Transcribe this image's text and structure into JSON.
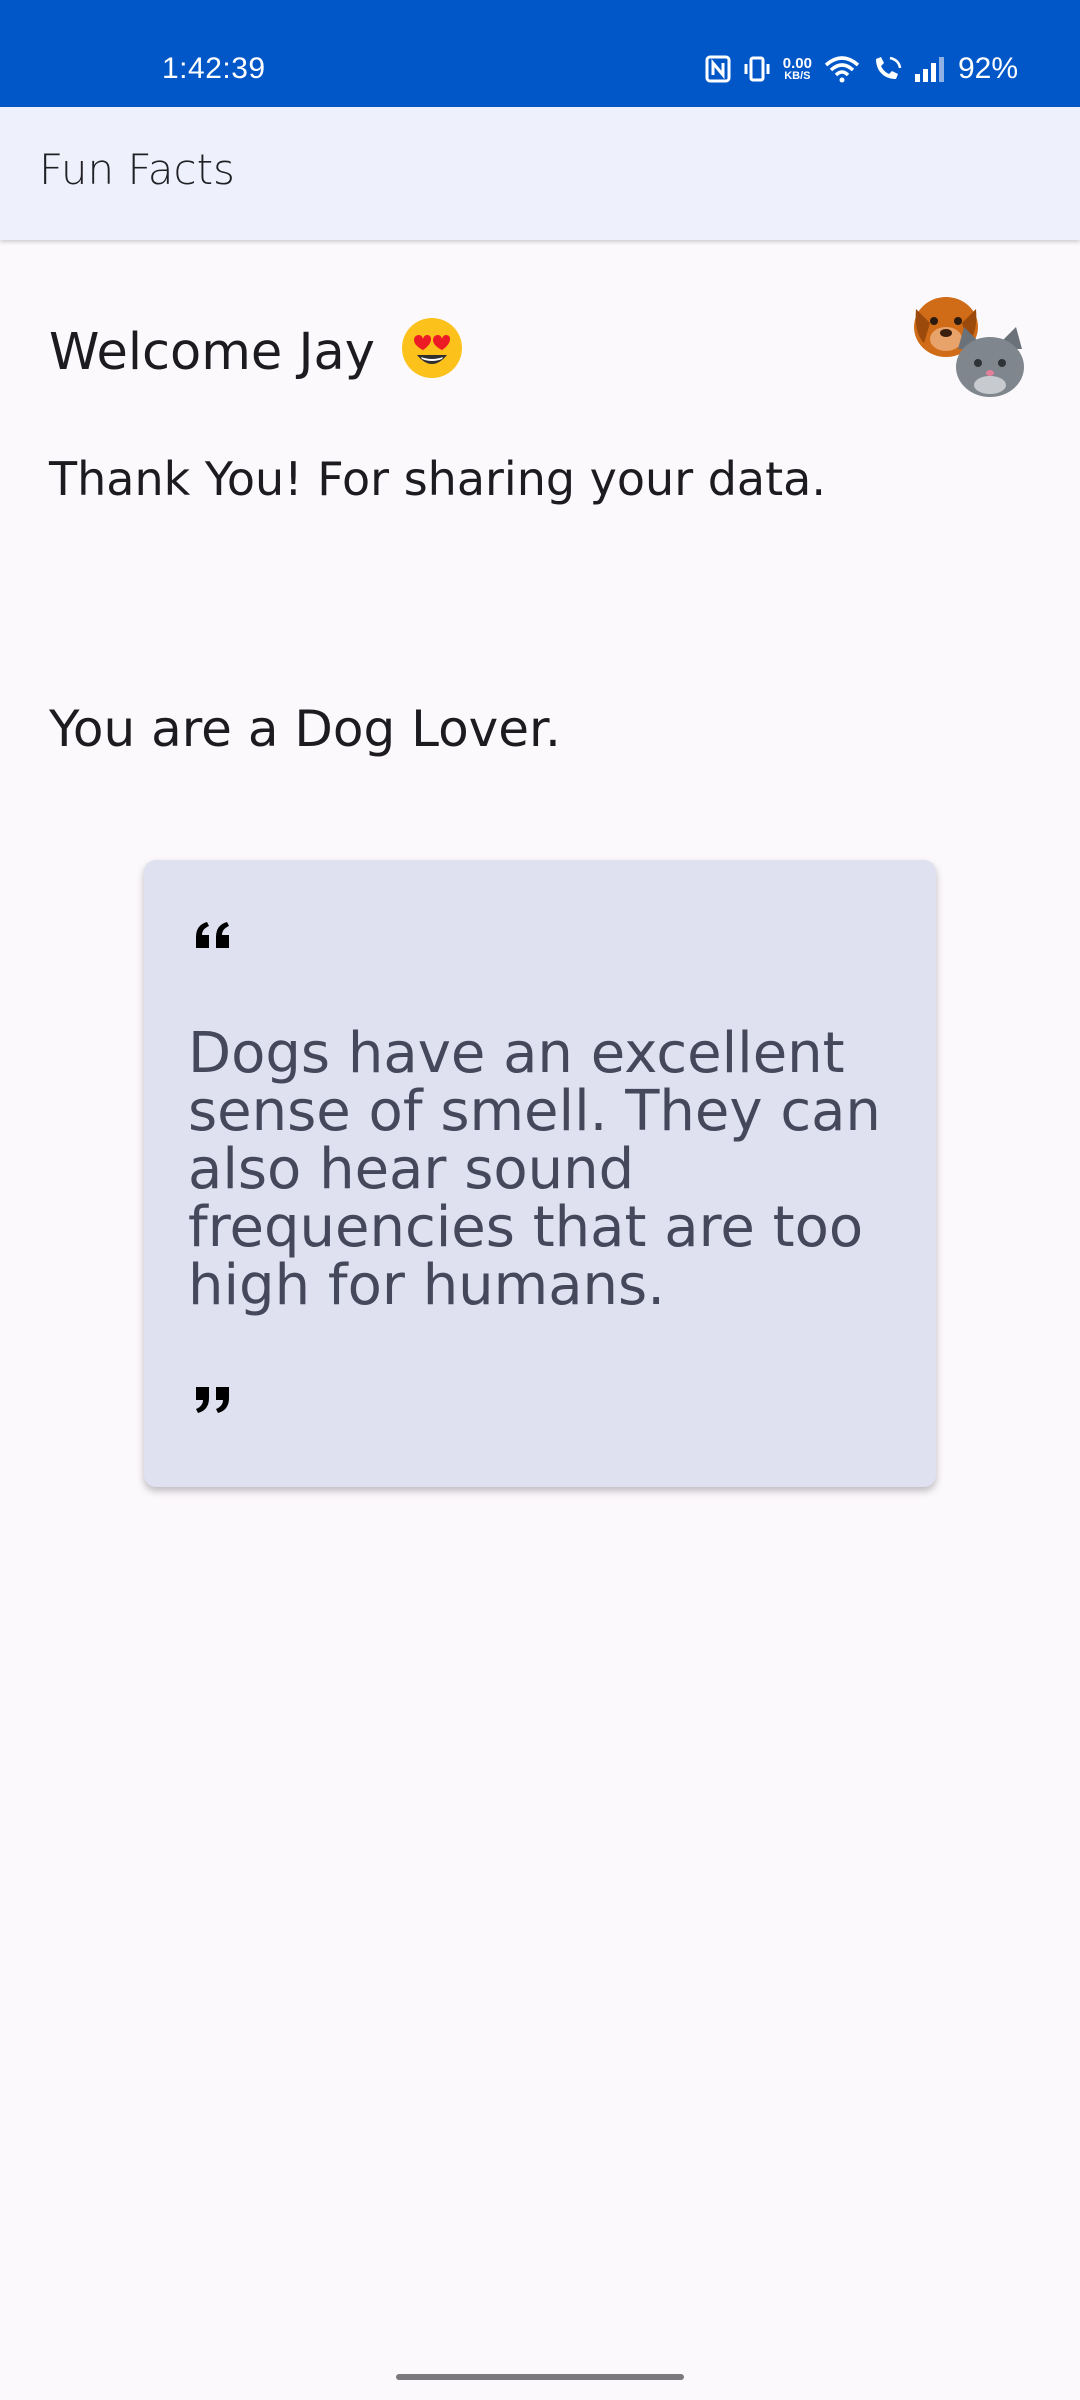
{
  "status_bar": {
    "time": "1:42:39",
    "net_speed_value": "0.00",
    "net_speed_unit": "KB/S",
    "battery": "92%"
  },
  "app_bar": {
    "title": "Fun Facts"
  },
  "main": {
    "welcome": "Welcome Jay",
    "welcome_emoji": "heart-eyes-emoji",
    "thanks": "Thank You! For sharing your data.",
    "result": "You are a Dog Lover.",
    "pets_icon": "dog-cat-icon"
  },
  "quote_card": {
    "open_mark": "❝",
    "text": "Dogs have an excellent sense of smell. They can also hear sound frequencies that are too high for humans.",
    "close_mark": "❞"
  },
  "colors": {
    "status_bar": "#0157c8",
    "app_bar": "#eef0fb",
    "background": "#fcf9fd",
    "card": "#dfe1f1",
    "quote_text": "#45475b"
  }
}
